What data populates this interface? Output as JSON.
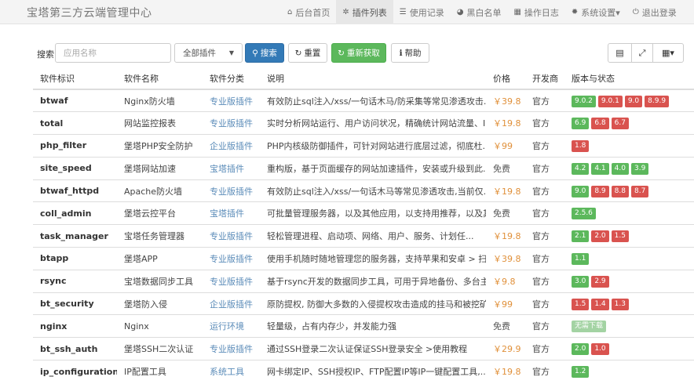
{
  "app": {
    "title": "宝塔第三方云端管理中心"
  },
  "nav": [
    {
      "icon": "home-icon",
      "glyph": "⌂",
      "label": "后台首页",
      "active": false
    },
    {
      "icon": "puzzle-icon",
      "glyph": "✲",
      "label": "插件列表",
      "active": true
    },
    {
      "icon": "list-icon",
      "glyph": "☰",
      "label": "使用记录",
      "active": false
    },
    {
      "icon": "globe-icon",
      "glyph": "◕",
      "label": "黑白名单",
      "active": false
    },
    {
      "icon": "calendar-icon",
      "glyph": "▦",
      "label": "操作日志",
      "active": false
    },
    {
      "icon": "gear-icon",
      "glyph": "✹",
      "label": "系统设置▾",
      "active": false
    },
    {
      "icon": "power-icon",
      "glyph": "⏻",
      "label": "退出登录",
      "active": false
    }
  ],
  "toolbar": {
    "search_label": "搜索",
    "search_placeholder": "应用名称",
    "filter_value": "全部插件",
    "search_button": "搜索",
    "reset_button": "重置",
    "refetch_button": "重新获取",
    "help_button": "帮助"
  },
  "table": {
    "headers": [
      "软件标识",
      "软件名称",
      "软件分类",
      "说明",
      "价格",
      "开发商",
      "版本与状态"
    ],
    "rows": [
      {
        "id": "btwaf",
        "name": "Nginx防火墙",
        "category": "专业版插件",
        "desc": "有效防止sql注入/xss/一句话木马/防采集等常见渗透攻击...",
        "price": "￥39.8",
        "vendor": "官方",
        "versions": [
          {
            "v": "9.0.2",
            "c": "g"
          },
          {
            "v": "9.0.1",
            "c": "r"
          },
          {
            "v": "9.0",
            "c": "r"
          },
          {
            "v": "8.9.9",
            "c": "r"
          }
        ]
      },
      {
        "id": "total",
        "name": "网站监控报表",
        "category": "专业版插件",
        "desc": "实时分析网站运行、用户访问状况，精确统计网站流量、I...",
        "price": "￥19.8",
        "vendor": "官方",
        "versions": [
          {
            "v": "6.9",
            "c": "g"
          },
          {
            "v": "6.8",
            "c": "r"
          },
          {
            "v": "6.7",
            "c": "r"
          }
        ]
      },
      {
        "id": "php_filter",
        "name": "堡塔PHP安全防护",
        "category": "企业版插件",
        "desc": "PHP内核级防御插件，可针对网站进行底层过滤，彻底杜...",
        "price": "￥99",
        "vendor": "官方",
        "versions": [
          {
            "v": "1.8",
            "c": "r"
          }
        ]
      },
      {
        "id": "site_speed",
        "name": "堡塔网站加速",
        "category": "宝塔插件",
        "desc": "重构版，基于页面缓存的网站加速插件，安装或升级到此...",
        "price": "免费",
        "vendor": "官方",
        "versions": [
          {
            "v": "4.2",
            "c": "g"
          },
          {
            "v": "4.1",
            "c": "g"
          },
          {
            "v": "4.0",
            "c": "g"
          },
          {
            "v": "3.9",
            "c": "g"
          }
        ]
      },
      {
        "id": "btwaf_httpd",
        "name": "Apache防火墙",
        "category": "专业版插件",
        "desc": "有效防止sql注入/xss/一句话木马等常见渗透攻击,当前仅...",
        "price": "￥19.8",
        "vendor": "官方",
        "versions": [
          {
            "v": "9.0",
            "c": "g"
          },
          {
            "v": "8.9",
            "c": "r"
          },
          {
            "v": "8.8",
            "c": "r"
          },
          {
            "v": "8.7",
            "c": "r"
          }
        ]
      },
      {
        "id": "coll_admin",
        "name": "堡塔云控平台",
        "category": "宝塔插件",
        "desc": "可批量管理服务器，以及其他应用，以支持用推荐，以及其...",
        "price": "免费",
        "vendor": "官方",
        "versions": [
          {
            "v": "2.5.6",
            "c": "g"
          }
        ]
      },
      {
        "id": "task_manager",
        "name": "宝塔任务管理器",
        "category": "专业版插件",
        "desc": "轻松管理进程、启动项、网络、用户、服务、计划任...",
        "price": "￥19.8",
        "vendor": "官方",
        "versions": [
          {
            "v": "2.1",
            "c": "g"
          },
          {
            "v": "2.0",
            "c": "r"
          },
          {
            "v": "1.5",
            "c": "r"
          }
        ]
      },
      {
        "id": "btapp",
        "name": "堡塔APP",
        "category": "专业版插件",
        "desc": "使用手机随时随地管理您的服务器，支持苹果和安卓 > 扫",
        "price": "￥39.8",
        "vendor": "官方",
        "versions": [
          {
            "v": "1.1",
            "c": "g"
          }
        ]
      },
      {
        "id": "rsync",
        "name": "宝塔数据同步工具",
        "category": "专业版插件",
        "desc": "基于rsync开发的数据同步工具，可用于异地备份、多台主...",
        "price": "￥9.8",
        "vendor": "官方",
        "versions": [
          {
            "v": "3.0",
            "c": "g"
          },
          {
            "v": "2.9",
            "c": "r"
          }
        ]
      },
      {
        "id": "bt_security",
        "name": "堡塔防入侵",
        "category": "企业版插件",
        "desc": "原防提权, 防御大多数的入侵提权攻击造成的挂马和被挖矿...",
        "price": "￥99",
        "vendor": "官方",
        "versions": [
          {
            "v": "1.5",
            "c": "r"
          },
          {
            "v": "1.4",
            "c": "r"
          },
          {
            "v": "1.3",
            "c": "r"
          }
        ]
      },
      {
        "id": "nginx",
        "name": "Nginx",
        "category": "运行环境",
        "desc": "轻量级，占有内存少，并发能力强",
        "price": "免费",
        "vendor": "官方",
        "versions": [
          {
            "v": "无需下载",
            "c": "lg"
          }
        ]
      },
      {
        "id": "bt_ssh_auth",
        "name": "堡塔SSH二次认证",
        "category": "专业版插件",
        "desc": "通过SSH登录二次认证保证SSH登录安全 >使用教程",
        "price": "￥29.9",
        "vendor": "官方",
        "versions": [
          {
            "v": "2.0",
            "c": "g"
          },
          {
            "v": "1.0",
            "c": "r"
          }
        ]
      },
      {
        "id": "ip_configuration",
        "name": "IP配置工具",
        "category": "系统工具",
        "desc": "网卡绑定IP、SSH授权IP、FTP配置IP等IP一键配置工具,...",
        "price": "￥19.8",
        "vendor": "官方",
        "versions": [
          {
            "v": "1.2",
            "c": "g"
          }
        ]
      }
    ]
  }
}
